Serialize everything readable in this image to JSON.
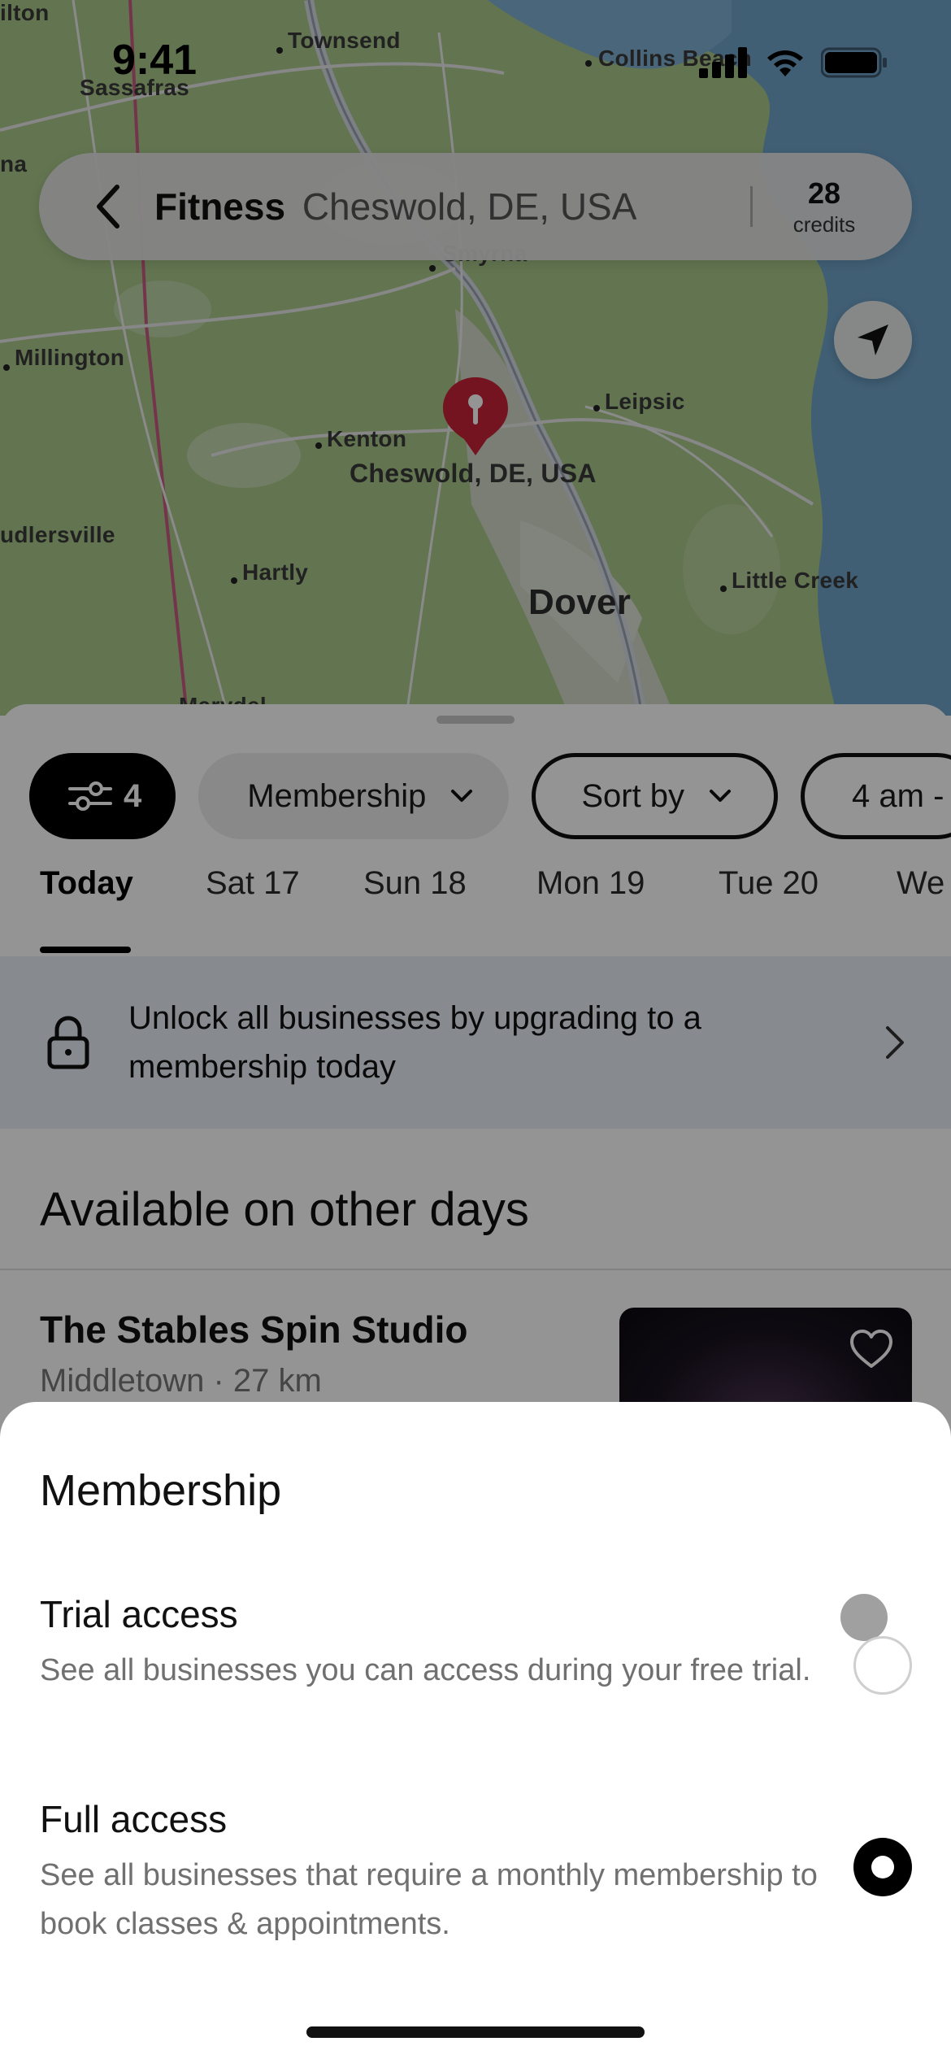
{
  "status_bar": {
    "time": "9:41"
  },
  "map": {
    "labels": {
      "townsend": "Townsend",
      "sassafras": "Sassafras",
      "collins_beach": "Collins Beach",
      "smyrna": "Smyrna",
      "millington": "Millington",
      "leipsic": "Leipsic",
      "kenton": "Kenton",
      "cheswold": "Cheswold, DE, USA",
      "sudlersville": "udlersville",
      "hartly": "Hartly",
      "dover": "Dover",
      "little_creek": "Little Creek",
      "marydel": "Marydel",
      "top_left": "ilton",
      "left_ma": "na"
    }
  },
  "search": {
    "category": "Fitness",
    "location": "Cheswold, DE, USA",
    "credits_count": "28",
    "credits_label": "credits"
  },
  "filters": {
    "filter_count": "4",
    "membership_label": "Membership",
    "sort_label": "Sort by",
    "time_label": "4 am -"
  },
  "days": [
    "Today",
    "Sat 17",
    "Sun 18",
    "Mon 19",
    "Tue 20",
    "We"
  ],
  "banner": {
    "text": "Unlock all businesses by upgrading to a membership today"
  },
  "listing": {
    "section_title": "Available on other days",
    "business_name": "The Stables Spin Studio",
    "business_meta": "Middletown · 27 km"
  },
  "modal": {
    "title": "Membership",
    "options": [
      {
        "title": "Trial access",
        "description": "See all businesses you can access during your free trial.",
        "selected": false
      },
      {
        "title": "Full access",
        "description": "See all businesses that require a monthly membership to book classes & appointments.",
        "selected": true
      }
    ]
  },
  "colors": {
    "accent": "#000000",
    "pin": "#c8243a",
    "map_land": "#a9c98a",
    "map_water": "#6fa3c9"
  }
}
